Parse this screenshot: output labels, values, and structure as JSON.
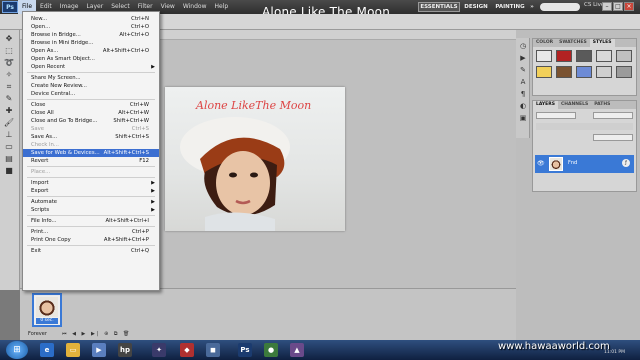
{
  "app": {
    "logo": "Ps",
    "menus": [
      "File",
      "Edit",
      "Image",
      "Layer",
      "Select",
      "Filter",
      "View",
      "Window",
      "Help"
    ],
    "document_title": "Alone Like The Moon",
    "workspaces": [
      "ESSENTIALS",
      "DESIGN",
      "PAINTING"
    ],
    "more": "»",
    "cs_live": "CS Live"
  },
  "file_menu": {
    "items": [
      {
        "label": "New...",
        "shortcut": "Ctrl+N"
      },
      {
        "label": "Open...",
        "shortcut": "Ctrl+O"
      },
      {
        "label": "Browse in Bridge...",
        "shortcut": "Alt+Ctrl+O"
      },
      {
        "label": "Browse in Mini Bridge...",
        "shortcut": ""
      },
      {
        "label": "Open As...",
        "shortcut": "Alt+Shift+Ctrl+O"
      },
      {
        "label": "Open As Smart Object...",
        "shortcut": ""
      },
      {
        "label": "Open Recent",
        "shortcut": "",
        "submenu": true
      },
      {
        "label": "Share My Screen...",
        "shortcut": ""
      },
      {
        "label": "Create New Review...",
        "shortcut": ""
      },
      {
        "label": "Device Central...",
        "shortcut": ""
      },
      {
        "label": "Close",
        "shortcut": "Ctrl+W"
      },
      {
        "label": "Close All",
        "shortcut": "Alt+Ctrl+W"
      },
      {
        "label": "Close and Go To Bridge...",
        "shortcut": "Shift+Ctrl+W"
      },
      {
        "label": "Save",
        "shortcut": "Ctrl+S",
        "disabled": true
      },
      {
        "label": "Save As...",
        "shortcut": "Shift+Ctrl+S"
      },
      {
        "label": "Check In...",
        "shortcut": "",
        "disabled": true
      },
      {
        "label": "Save for Web & Devices...",
        "shortcut": "Alt+Shift+Ctrl+S",
        "highlighted": true
      },
      {
        "label": "Revert",
        "shortcut": "F12"
      },
      {
        "label": "Place...",
        "shortcut": "",
        "disabled": true
      },
      {
        "label": "Import",
        "shortcut": "",
        "submenu": true
      },
      {
        "label": "Export",
        "shortcut": "",
        "submenu": true
      },
      {
        "label": "Automate",
        "shortcut": "",
        "submenu": true
      },
      {
        "label": "Scripts",
        "shortcut": "",
        "submenu": true
      },
      {
        "label": "File Info...",
        "shortcut": "Alt+Shift+Ctrl+I"
      },
      {
        "label": "Print...",
        "shortcut": "Ctrl+P"
      },
      {
        "label": "Print One Copy",
        "shortcut": "Alt+Shift+Ctrl+P"
      },
      {
        "label": "Exit",
        "shortcut": "Ctrl+Q"
      }
    ]
  },
  "artwork": {
    "text": "Alone LikeThe Moon"
  },
  "panels": {
    "top_tabs": [
      "COLOR",
      "SWATCHES",
      "STYLES"
    ],
    "layer_tabs": [
      "LAYERS",
      "CHANNELS",
      "PATHS"
    ],
    "layer_name": "Fnd",
    "style_colors": [
      "#e8e8e8",
      "#b22222",
      "#5a5a5a",
      "#d9d9d9",
      "#c0c0c0",
      "#f2d05a",
      "#7a5230",
      "#6d8bd6",
      "#cfcfcf",
      "#9b9b9b",
      "#8fa6c9",
      "#f08030",
      "#3c3c3c",
      "#b0c4de",
      "#e0e0ff",
      "#c98a5a",
      "#e6e6e6",
      "#4a4a8a",
      "#d0a070",
      "#a0c8e8"
    ]
  },
  "animation": {
    "frame_label": "1",
    "frame_time": "0 sec.",
    "loop": "Forever"
  },
  "taskbar": {
    "watermark": "www.hawaaworld.com",
    "tray_time": "11:01 PM"
  },
  "colors": {
    "highlight": "#3c6fd1",
    "layer_selected": "#3a79d6",
    "artwork_text": "#dd4444"
  }
}
